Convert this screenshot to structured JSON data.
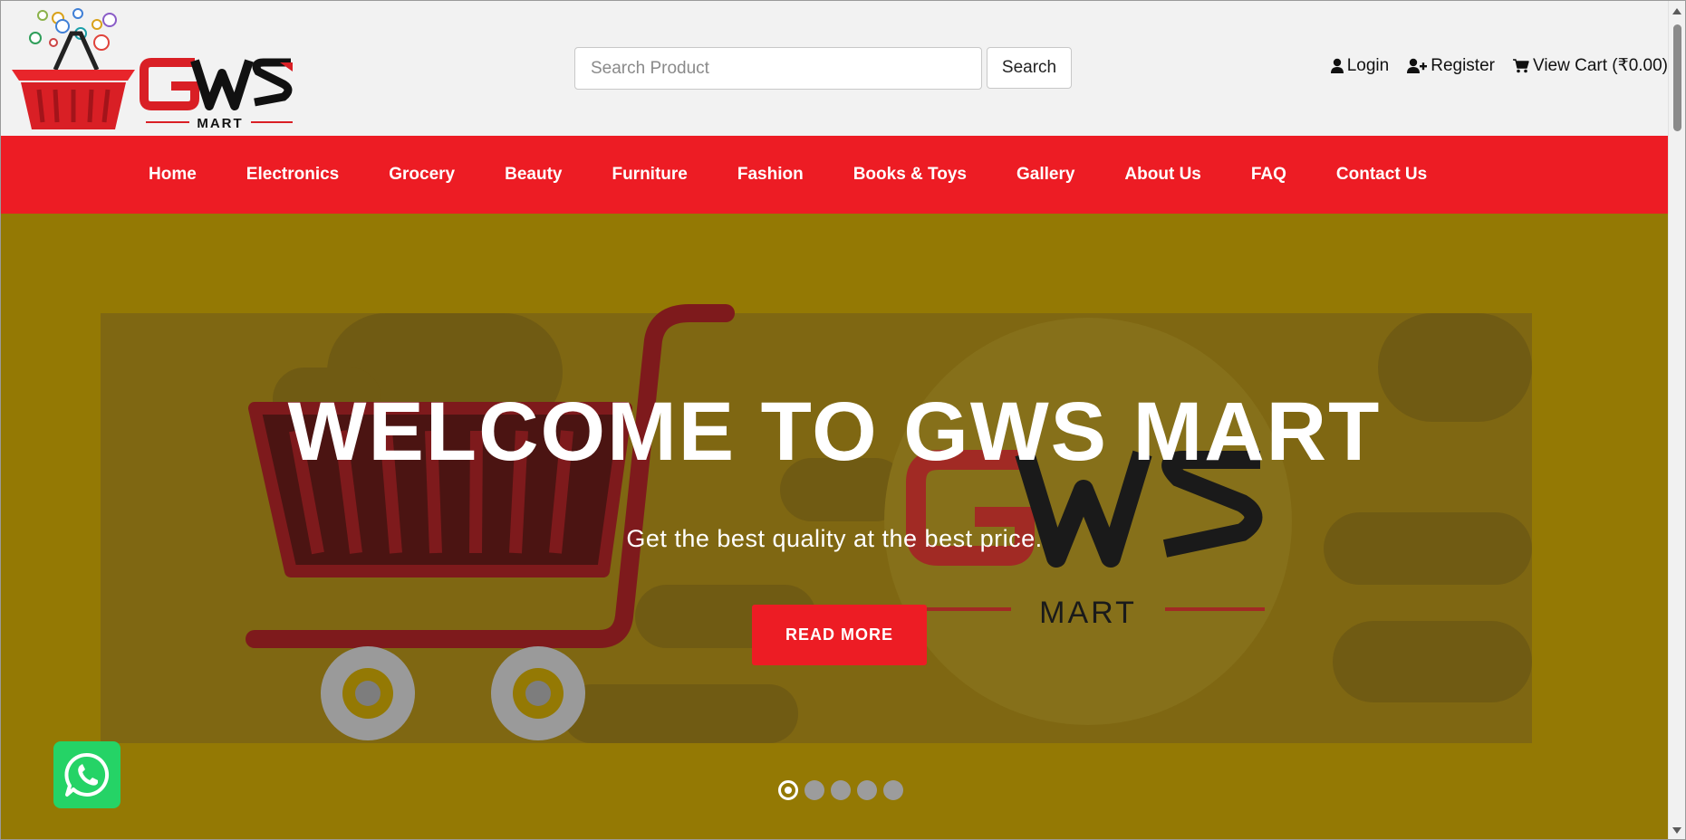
{
  "header": {
    "logo": {
      "wordmark": "GWS",
      "tagline": "MART",
      "icon": "shopping-basket-icon"
    },
    "search": {
      "placeholder": "Search Product",
      "value": "",
      "button_label": "Search"
    },
    "account": {
      "login_label": "Login",
      "login_icon": "user-icon",
      "register_label": "Register",
      "register_icon": "user-plus-icon",
      "cart_label": "View Cart (₹0.00)",
      "cart_icon": "cart-icon"
    }
  },
  "nav": {
    "items": [
      {
        "label": "Home"
      },
      {
        "label": "Electronics"
      },
      {
        "label": "Grocery"
      },
      {
        "label": "Beauty"
      },
      {
        "label": "Furniture"
      },
      {
        "label": "Fashion"
      },
      {
        "label": "Books & Toys"
      },
      {
        "label": "Gallery"
      },
      {
        "label": "About Us"
      },
      {
        "label": "FAQ"
      },
      {
        "label": "Contact Us"
      }
    ]
  },
  "hero": {
    "title": "WELCOME TO GWS MART",
    "subtitle": "Get the best quality at the best price.",
    "button_label": "READ MORE",
    "slide_count": 5,
    "active_slide": 1,
    "background_image": {
      "wordmark": "GWS",
      "tagline": "MART"
    }
  },
  "whatsapp": {
    "icon": "whatsapp-icon"
  },
  "colors": {
    "brand_red": "#ed1c24",
    "hero_background": "#947904",
    "header_background": "#f2f2f2"
  }
}
